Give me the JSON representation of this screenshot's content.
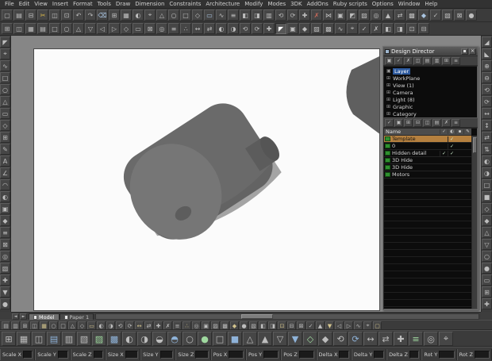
{
  "menu": {
    "items": [
      "File",
      "Edit",
      "View",
      "Insert",
      "Format",
      "Tools",
      "Draw",
      "Dimension",
      "Constraints",
      "Architecture",
      "Modify",
      "Modes",
      "3DK",
      "AddOns",
      "Ruby scripts",
      "Options",
      "Window",
      "Help"
    ]
  },
  "toolbars": {
    "top1": [
      "▢",
      "▤",
      "⊟",
      "✂",
      "◫",
      "⊡",
      "↶",
      "↷",
      "⌫",
      "⊞",
      "▦",
      "◐",
      "⌖",
      "△",
      "○",
      "□",
      "◇",
      "▭",
      "∿",
      "≡",
      "◧",
      "◨",
      "▥",
      "⟲",
      "⟳",
      "✚",
      "✗",
      "⋈",
      "▣",
      "◩",
      "▨",
      "◎",
      "▲",
      "⇄",
      "▩",
      "◆",
      "✓",
      "▧",
      "⊠",
      "●"
    ],
    "top2": [
      "⊞",
      "◫",
      "▦",
      "▤",
      "□",
      "○",
      "△",
      "▽",
      "◁",
      "▷",
      "◇",
      "▭",
      "⊠",
      "◎",
      "≡",
      "∴",
      "↔",
      "⇄",
      "◐",
      "◑",
      "⟲",
      "⟳",
      "✚",
      "◤",
      "▣",
      "◆",
      "▨",
      "▩",
      "∿",
      "⌖",
      "✓",
      "✗",
      "◧",
      "◨",
      "⊡",
      "⊟"
    ],
    "left": [
      "◤",
      "⌖",
      "∿",
      "□",
      "○",
      "△",
      "▭",
      "◇",
      "⊞",
      "✎",
      "A",
      "∠",
      "◠",
      "◐",
      "▣",
      "◆",
      "≡",
      "⊠",
      "◎",
      "▧",
      "✚",
      "▼",
      "●"
    ],
    "right": [
      "◢",
      "◣",
      "⊕",
      "⊖",
      "⟲",
      "⟳",
      "↔",
      "↕",
      "⇄",
      "⇅",
      "◐",
      "◑",
      "□",
      "■",
      "◇",
      "◆",
      "△",
      "▽",
      "○",
      "●",
      "▭",
      "⊞",
      "✚"
    ],
    "bottom1": [
      "▤",
      "▥",
      "⊞",
      "◫",
      "▦",
      "○",
      "□",
      "△",
      "◇",
      "▭",
      "◐",
      "◑",
      "⟲",
      "⟳",
      "↔",
      "⇄",
      "✚",
      "✗",
      "≡",
      "∴",
      "◎",
      "▣",
      "▨",
      "▩",
      "◆",
      "●",
      "▧",
      "◧",
      "◨",
      "⊡",
      "⊟",
      "⊠",
      "✓",
      "▲",
      "▼",
      "◁",
      "▷",
      "∿",
      "⌖",
      "▢"
    ],
    "bottom2": [
      "⊞",
      "▦",
      "◫",
      "▤",
      "▥",
      "▧",
      "▨",
      "▩",
      "◐",
      "◑",
      "◒",
      "◓",
      "○",
      "●",
      "□",
      "■",
      "△",
      "▲",
      "▽",
      "▼",
      "◇",
      "◆",
      "⟲",
      "⟳",
      "↔",
      "⇄",
      "✚",
      "≡",
      "◎",
      "⌖"
    ]
  },
  "canvas": {
    "nav_icons": [
      "◄",
      "►"
    ],
    "tabs": [
      {
        "label": "Model",
        "cls": "active"
      },
      {
        "label": "Paper 1"
      }
    ]
  },
  "panel": {
    "title": "Design Director",
    "buttons": [
      "▪",
      "✕"
    ],
    "toolbar1": [
      "▣",
      "✓",
      "✗",
      "◫",
      "▤",
      "▥",
      "⊞",
      "≡"
    ],
    "toolbar2": [
      "✓",
      "▣",
      "⊞",
      "⊟",
      "◫",
      "▤",
      "✗",
      "≡"
    ],
    "tree": [
      {
        "exp": "▣",
        "label": "Layer",
        "cls": "sel"
      },
      {
        "exp": "⊞",
        "label": "WorkPlane"
      },
      {
        "exp": "⊞",
        "label": "View (1)"
      },
      {
        "exp": "⊞",
        "label": "Camera"
      },
      {
        "exp": "⊞",
        "label": "Light (8)"
      },
      {
        "exp": "⊞",
        "label": "Graphic"
      },
      {
        "exp": "⊞",
        "label": "Category"
      }
    ],
    "table": {
      "name_header": "Name",
      "header_cols": [
        "✓",
        "◐",
        "▪",
        "✎"
      ],
      "rows": [
        {
          "name": "Template",
          "cls": "hl",
          "c1": "",
          "c2": "✓",
          "c3": "",
          "c4": ""
        },
        {
          "name": "0",
          "c1": "",
          "c2": "✓",
          "c3": "",
          "c4": ""
        },
        {
          "name": "Hidden detail",
          "c1": "✓",
          "c2": "✓",
          "c3": "",
          "c4": ""
        },
        {
          "name": "3D Hide",
          "c1": "",
          "c2": "",
          "c3": "",
          "c4": ""
        },
        {
          "name": "3D Hide",
          "c1": "",
          "c2": "",
          "c3": "",
          "c4": ""
        },
        {
          "name": "Motors",
          "c1": "",
          "c2": "",
          "c3": "",
          "c4": ""
        }
      ]
    }
  },
  "statusbar": {
    "fields": [
      "Scale X",
      "Scale Y",
      "Scale Z",
      "Size X",
      "Size Y",
      "Size Z",
      "Pos X",
      "Pos Y",
      "Pos Z",
      "Delta X",
      "Delta Y",
      "Delta Z",
      "Rot Y",
      "Rot Z"
    ]
  },
  "colors": {
    "highlight_row": "#b5803f",
    "tree_selection": "#2d5a9e",
    "object_body": "#6a6a6a",
    "object_face": "#767676",
    "paper": "#fbfbfb"
  }
}
